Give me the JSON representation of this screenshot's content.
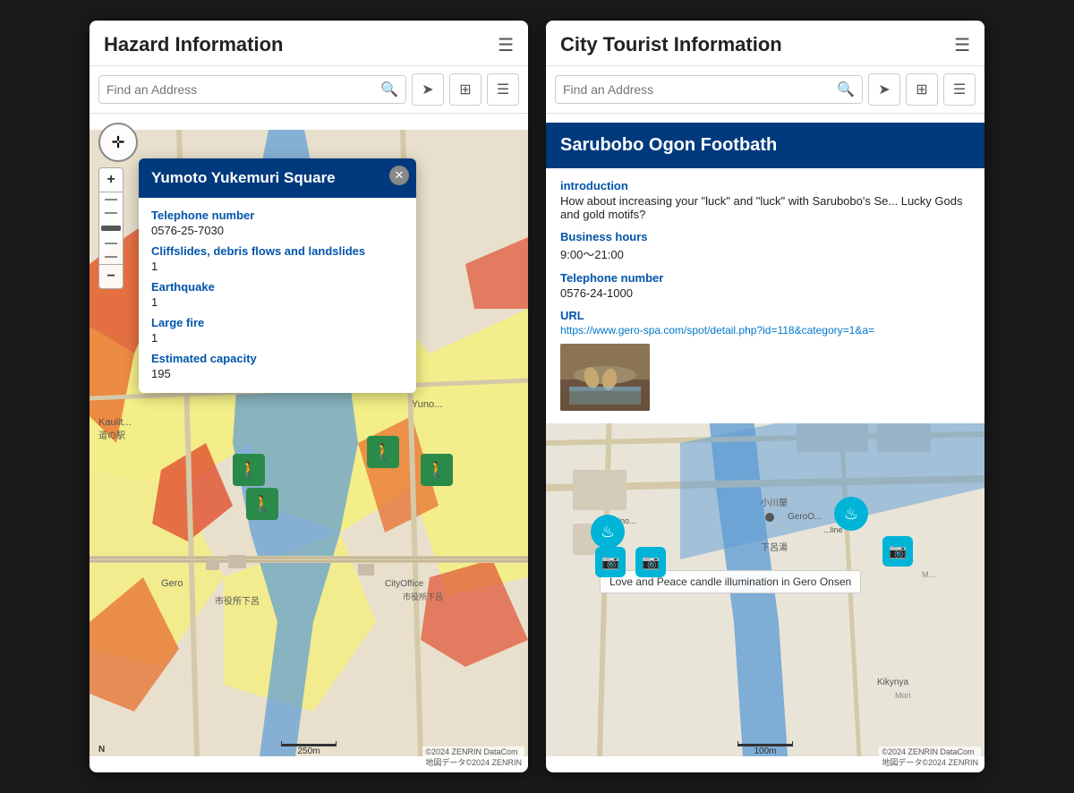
{
  "left_panel": {
    "title": "Hazard Information",
    "hamburger": "☰",
    "search": {
      "placeholder": "Find an Address"
    },
    "toolbar": {
      "search_label": "🔍",
      "location_label": "➤",
      "layers_label": "⊞",
      "list_label": "☰"
    },
    "popup": {
      "title": "Yumoto Yukemuri Square",
      "close": "✕",
      "fields": [
        {
          "label": "Telephone number",
          "value": "0576-25-7030"
        },
        {
          "label": "Cliffslides, debris flows and landslides",
          "value": "1"
        },
        {
          "label": "Earthquake",
          "value": "1"
        },
        {
          "label": "Large fire",
          "value": "1"
        },
        {
          "label": "Estimated capacity",
          "value": "195"
        }
      ]
    },
    "attribution": "©2024 ZENRIN DataCom\n地図データ©2024 ZENRIN",
    "scale": "250m",
    "north": "N"
  },
  "right_panel": {
    "title": "City Tourist Information",
    "hamburger": "☰",
    "search": {
      "placeholder": "Find an Address"
    },
    "popup": {
      "title": "Sarubobo Ogon Footbath",
      "fields": [
        {
          "label": "introduction",
          "value": "How about increasing your \"luck\" and \"luck\" with Sarubobo's Seven Lucky Gods and gold motifs?"
        },
        {
          "label": "Business hours",
          "value": "9:00～21:00"
        },
        {
          "label": "Telephone number",
          "value": "0576-24-1000"
        },
        {
          "label": "URL",
          "value": "https://www.gero-spa.com/spot/detail.php?id=118&category=1&a="
        }
      ]
    },
    "map_tooltip": {
      "text": "Love and Peace candle illumination in Gero Onsen"
    },
    "attribution": "©2024 ZENRIN DataCom\n地図データ©2024 ZENRIN",
    "scale": "100m"
  }
}
